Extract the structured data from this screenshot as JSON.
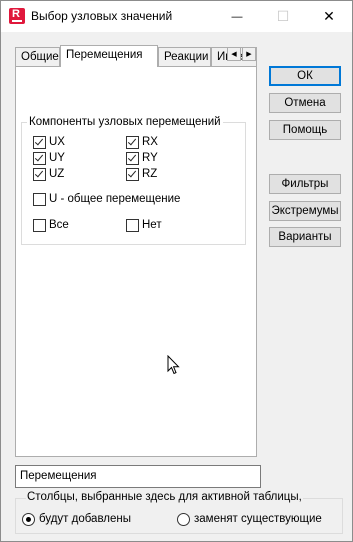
{
  "window": {
    "title": "Выбор узловых значений"
  },
  "titlebar": {
    "minimize": "—",
    "maximize": "☐",
    "close": "✕"
  },
  "tabs": [
    {
      "label": "Общие",
      "active": false
    },
    {
      "label": "Перемещения",
      "active": true
    },
    {
      "label": "Реакции",
      "active": false
    },
    {
      "label": "Инте",
      "active": false
    }
  ],
  "group": {
    "title": "Компоненты узловых перемещений",
    "checkboxes": [
      {
        "label": "UX",
        "checked": true
      },
      {
        "label": "RX",
        "checked": true
      },
      {
        "label": "UY",
        "checked": true
      },
      {
        "label": "RY",
        "checked": true
      },
      {
        "label": "UZ",
        "checked": true
      },
      {
        "label": "RZ",
        "checked": true
      },
      {
        "label": "U - общее перемещение",
        "checked": false
      },
      {
        "label": "Все",
        "checked": false
      },
      {
        "label": "Нет",
        "checked": false
      }
    ]
  },
  "buttons": {
    "ok": "ОК",
    "cancel": "Отмена",
    "help": "Помощь",
    "filters": "Фильтры",
    "extremes": "Экстремумы",
    "variants": "Варианты"
  },
  "name_field": {
    "value": "Перемещения"
  },
  "bottom": {
    "caption": "Столбцы, выбранные здесь для активной таблицы,",
    "radio_add": "будут добавлены",
    "radio_replace": "заменят существующие",
    "selected": "add"
  },
  "colors": {
    "accent": "#0078d7",
    "app_icon": "#e0183c"
  }
}
